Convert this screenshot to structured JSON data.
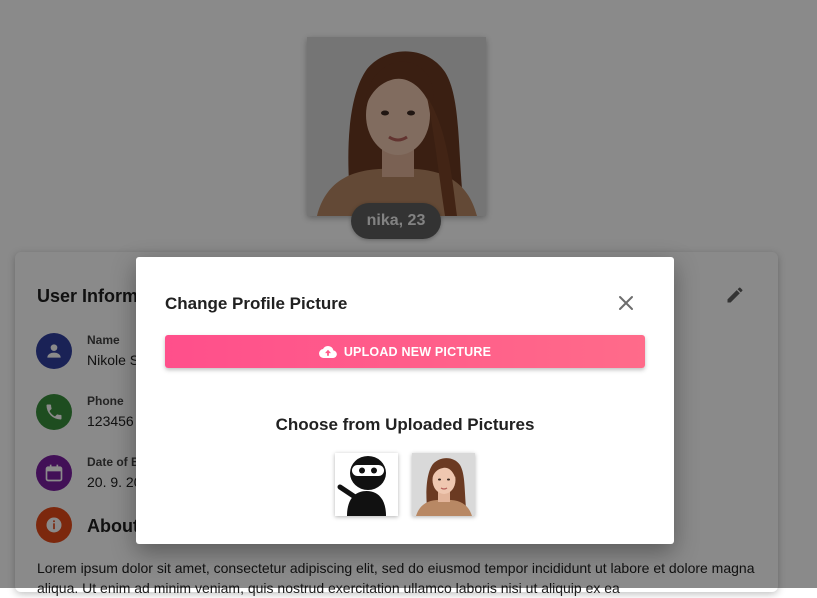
{
  "profile": {
    "name_chip": "nika, 23"
  },
  "info_card": {
    "title": "User Information",
    "fields": [
      {
        "label": "Name",
        "value": "Nikole S",
        "color": "#303f9f",
        "icon": "person-icon"
      },
      {
        "label": "Phone",
        "value": "123456",
        "color": "#388e3c",
        "icon": "phone-icon"
      },
      {
        "label": "Date of Birth",
        "value": "20. 9. 20",
        "color": "#7b1fa2",
        "icon": "calendar-icon"
      }
    ],
    "about_title": "About",
    "about_color": "#e64a19",
    "about_text": "Lorem ipsum dolor sit amet, consectetur adipiscing elit, sed do eiusmod tempor incididunt ut labore et dolore magna aliqua. Ut enim ad minim veniam, quis nostrud exercitation ullamco laboris nisi ut aliquip ex ea"
  },
  "dialog": {
    "title": "Change Profile Picture",
    "upload_label": "UPLOAD NEW PICTURE",
    "uploaded_title": "Choose from Uploaded Pictures",
    "accent": "#ff4f8b"
  }
}
